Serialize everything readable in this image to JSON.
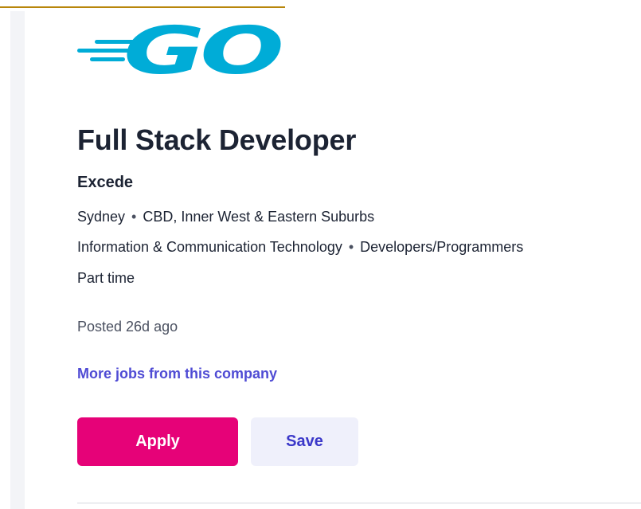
{
  "job": {
    "title": "Full Stack Developer",
    "company": "Excede",
    "location": "Sydney",
    "area": "CBD, Inner West & Eastern Suburbs",
    "classification": "Information & Communication Technology",
    "subclassification": "Developers/Programmers",
    "work_type": "Part time",
    "posted": "Posted 26d ago",
    "separator": "•"
  },
  "links": {
    "more_jobs": "More jobs from this company"
  },
  "actions": {
    "apply_label": "Apply",
    "save_label": "Save"
  },
  "logo": {
    "icon": "go-logo-icon",
    "text": "GO",
    "color": "#00acd7"
  },
  "colors": {
    "apply": "#e60278",
    "save_bg": "#eff0fb",
    "save_text": "#3b38c9",
    "link": "#4f4bd4",
    "text": "#1c2333"
  }
}
